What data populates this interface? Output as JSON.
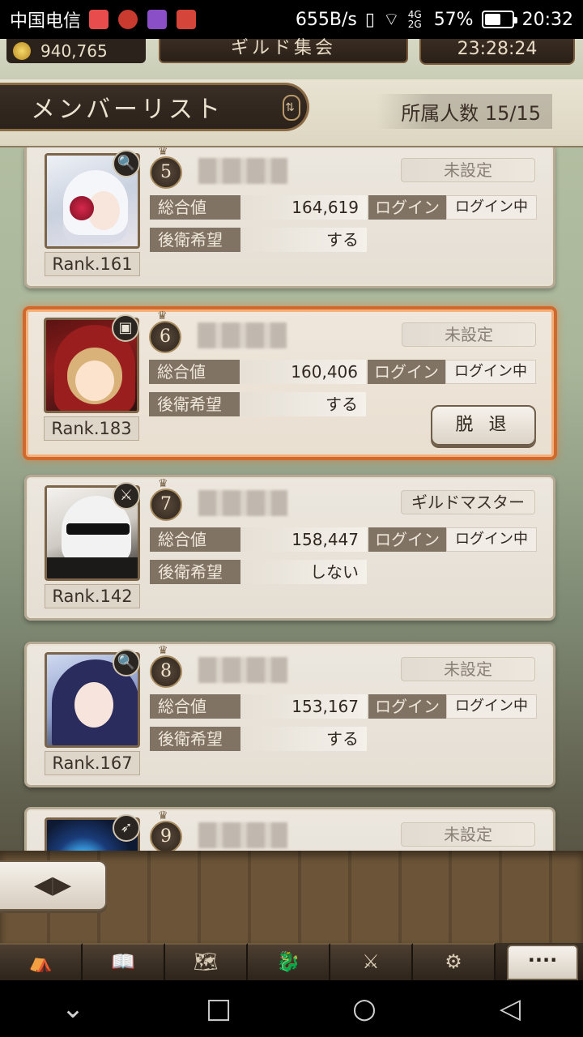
{
  "status_bar": {
    "carrier": "中国电信",
    "net_speed": "655B/s",
    "network": "4G 2G",
    "battery": "57%",
    "time": "20:32"
  },
  "hud": {
    "coins": "940,765",
    "title": "ギルド集会",
    "timer": "23:28:24"
  },
  "list_header": {
    "title": "メンバーリスト",
    "sort_icon": "⇅",
    "member_count_label": "所属人数",
    "member_count": "15/15"
  },
  "labels": {
    "total": "総合値",
    "login": "ログイン",
    "rear_guard": "後衛希望",
    "leave": "脱 退"
  },
  "members": [
    {
      "number": "5",
      "rank": "Rank.161",
      "weapon_icon": "magnifier-icon",
      "weapon_glyph": "🔍",
      "role": "未設定",
      "total": "164,619",
      "login": "ログイン中",
      "rear_guard": "する"
    },
    {
      "number": "6",
      "rank": "Rank.183",
      "weapon_icon": "tome-icon",
      "weapon_glyph": "▣",
      "role": "未設定",
      "total": "160,406",
      "login": "ログイン中",
      "rear_guard": "する"
    },
    {
      "number": "7",
      "rank": "Rank.142",
      "weapon_icon": "sword-icon",
      "weapon_glyph": "⚔",
      "role": "ギルドマスター",
      "total": "158,447",
      "login": "ログイン中",
      "rear_guard": "しない"
    },
    {
      "number": "8",
      "rank": "Rank.167",
      "weapon_icon": "magnifier-icon",
      "weapon_glyph": "🔍",
      "role": "未設定",
      "total": "153,167",
      "login": "ログイン中",
      "rear_guard": "する"
    },
    {
      "number": "9",
      "rank": "",
      "weapon_icon": "spear-icon",
      "weapon_glyph": "➶",
      "role": "未設定",
      "total": "",
      "login": "",
      "rear_guard": ""
    }
  ],
  "bottom": {
    "back_glyph": "◀▶",
    "menu_glyphs": [
      "⛺",
      "📖",
      "🗺",
      "🐉",
      "⚔",
      "⚙"
    ],
    "more": "····"
  },
  "navbar": {
    "back": "◁",
    "home": "○",
    "recent": "□",
    "collapse": "⌄"
  }
}
